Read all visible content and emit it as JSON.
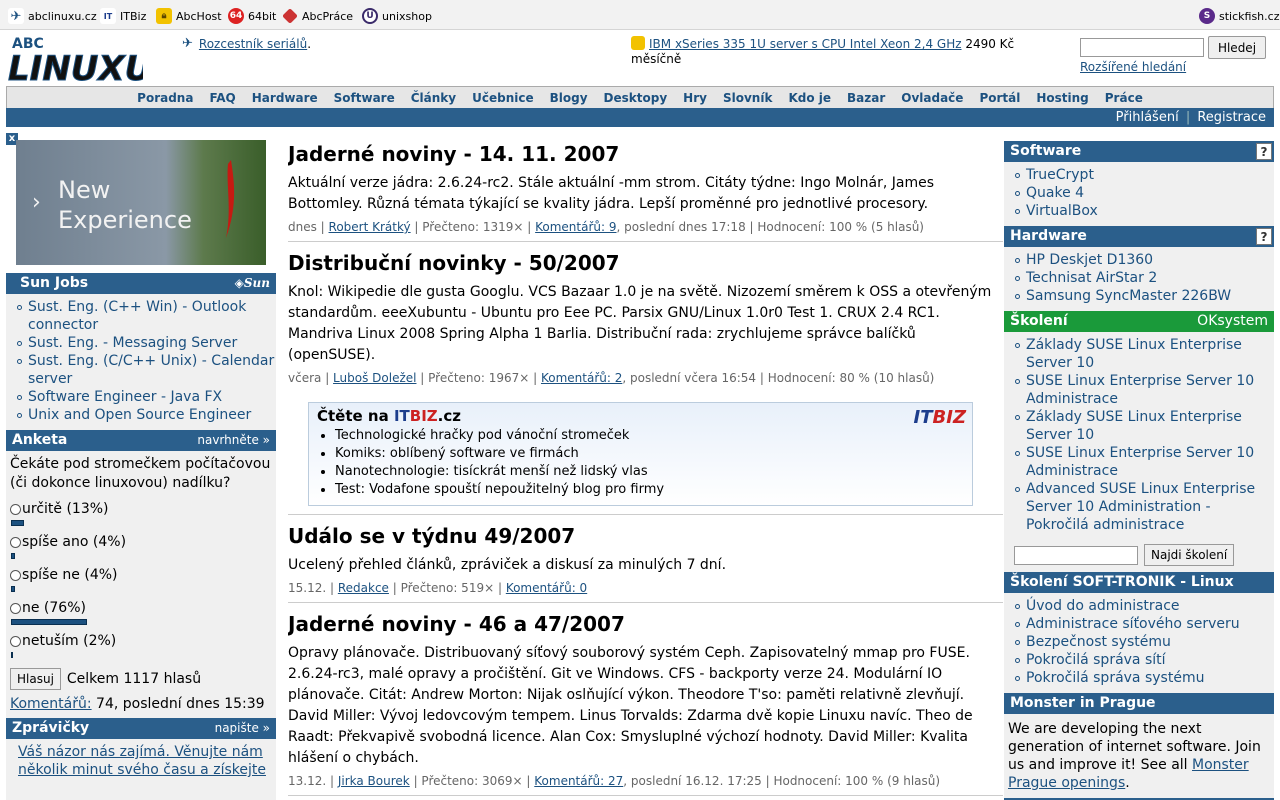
{
  "sitebar": {
    "left": [
      {
        "label": "abclinuxu.cz",
        "icon": "penguin-icon"
      },
      {
        "label": "ITBiz",
        "icon": "itbiz-icon"
      },
      {
        "label": "AbcHost",
        "icon": "lock-icon"
      },
      {
        "label": "64bit",
        "icon": "64bit-icon"
      },
      {
        "label": "AbcPráce",
        "icon": "abcprace-icon"
      },
      {
        "label": "unixshop",
        "icon": "unixshop-icon"
      }
    ],
    "right": {
      "label": "stickfish.cz",
      "icon": "stickfish-icon"
    }
  },
  "header": {
    "logo_text": "ABC LINUXU",
    "left_link": "Rozcestník seriálů",
    "left_suffix": ".",
    "mid_link": "IBM xSeries 335 1U server s CPU Intel Xeon 2,4 GHz",
    "mid_suffix": " 2490 Kč měsíčně",
    "search_button": "Hledej",
    "search_advanced": "Rozšířené hledání"
  },
  "menu": [
    "Poradna",
    "FAQ",
    "Hardware",
    "Software",
    "Články",
    "Učebnice",
    "Blogy",
    "Desktopy",
    "Hry",
    "Slovník",
    "Kdo je",
    "Bazar",
    "Ovladače",
    "Portál",
    "Hosting",
    "Práce"
  ],
  "login": {
    "login": "Přihlášení",
    "separator": "|",
    "register": "Registrace"
  },
  "ad": {
    "close": "x",
    "line1": "New",
    "line2": "Experience"
  },
  "sunjobs": {
    "title": "Sun Jobs",
    "logo": "Sun",
    "items": [
      "Sust. Eng. (C++ Win) - Outlook connector",
      "Sust. Eng. - Messaging Server",
      "Sust. Eng. (C/C++ Unix) - Calendar server",
      "Software Engineer - Java FX",
      "Unix and Open Source Engineer"
    ]
  },
  "poll": {
    "title": "Anketa",
    "action": "navrhněte »",
    "question": "Čekáte pod stromečkem počítačovou (či dokonce linuxovou) nadílku?",
    "options": [
      {
        "label": "určitě (13%)",
        "percent": 13
      },
      {
        "label": "spíše ano (4%)",
        "percent": 4
      },
      {
        "label": "spíše ne (4%)",
        "percent": 4
      },
      {
        "label": "ne (76%)",
        "percent": 76
      },
      {
        "label": "netuším (2%)",
        "percent": 2
      }
    ],
    "vote_button": "Hlasuj",
    "total": "Celkem 1117 hlasů",
    "comments_link": "Komentářů:",
    "comments_info": " 74, poslední dnes 15:39"
  },
  "news": {
    "title": "Zprávičky",
    "action": "napište »",
    "text": "Váš názor nás zajímá. Věnujte nám několik minut svého času a získejte"
  },
  "articles": [
    {
      "title": "Jaderné noviny - 14. 11. 2007",
      "perex": "Aktuální verze jádra: 2.6.24-rc2. Stále aktuální -mm strom. Citáty týdne: Ingo Molnár, James Bottomley. Různá témata týkající se kvality jádra. Lepší proměnné pro jednotlivé procesory.",
      "date": "dnes",
      "author": "Robert Krátký",
      "reads": "Přečteno: 1319×",
      "comments": "Komentářů: 9",
      "last": ", poslední dnes 17:18",
      "rating": "Hodnocení: 100 % (5 hlasů)"
    },
    {
      "title": "Distribuční novinky - 50/2007",
      "perex": "Knol: Wikipedie dle gusta Googlu. VCS Bazaar 1.0 je na světě. Nizozemí směrem k OSS a otevřeným standardům. eeeXubuntu - Ubuntu pro Eee PC. Parsix GNU/Linux 1.0r0 Test 1. CRUX 2.4 RC1. Mandriva Linux 2008 Spring Alpha 1 Barlia. Distribuční rada: zrychlujeme správce balíčků (openSUSE).",
      "date": "včera",
      "author": "Luboš Doležel",
      "reads": "Přečteno: 1967×",
      "comments": "Komentářů: 2",
      "last": ", poslední včera 16:54",
      "rating": "Hodnocení: 80 % (10 hlasů)"
    },
    {
      "title": "Událo se v týdnu 49/2007",
      "perex": "Ucelený přehled článků, zpráviček a diskusí za minulých 7 dní.",
      "date": "15.12.",
      "author": "Redakce",
      "reads": "Přečteno: 519×",
      "comments": "Komentářů: 0",
      "last": "",
      "rating": ""
    },
    {
      "title": "Jaderné noviny - 46 a 47/2007",
      "perex": "Opravy plánovače. Distribuovaný síťový souborový systém Ceph. Zapisovatelný mmap pro FUSE. 2.6.24-rc3, malé opravy a pročištění. Git ve Windows. CFS - backporty verze 24. Modulární IO plánovače. Citát: Andrew Morton: Nijak oslňující výkon. Theodore T'so: paměti relativně zlevňují. David Miller: Vývoj ledovcovým tempem. Linus Torvalds: Zdarma dvě kopie Linuxu navíc. Theo de Raadt: Překvapivě svobodná licence. Alan Cox: Smysluplné výchozí hodnoty. David Miller: Kvalita hlášení o chybách.",
      "date": "13.12.",
      "author": "Jirka Bourek",
      "reads": "Přečteno: 3069×",
      "comments": "Komentářů: 27",
      "last": ", poslední 16.12. 17:25",
      "rating": "Hodnocení: 100 % (9 hlasů)"
    }
  ],
  "itbiz": {
    "prefix": "Čtěte na ",
    "it": "IT",
    "biz": "BIZ",
    "suffix": ".cz",
    "logo": "ITBIZ",
    "items": [
      "Technologické hračky pod vánoční stromeček",
      "Komiks: oblíbený software ve firmách",
      "Nanotechnologie: tisíckrát menší než lidský vlas",
      "Test: Vodafone spouští nepoužitelný blog pro firmy"
    ]
  },
  "right": {
    "software": {
      "title": "Software",
      "help": "?",
      "items": [
        "TrueCrypt",
        "Quake 4",
        "VirtualBox"
      ]
    },
    "hardware": {
      "title": "Hardware",
      "help": "?",
      "items": [
        "HP Deskjet D1360",
        "Technisat AirStar 2",
        "Samsung SyncMaster 226BW"
      ]
    },
    "skoleni": {
      "title": "Školení",
      "sponsor": "OKsystem",
      "items": [
        "Základy SUSE Linux Enterprise Server 10",
        "SUSE Linux Enterprise Server 10 Administrace",
        "Základy SUSE Linux Enterprise Server 10",
        "SUSE Linux Enterprise Server 10 Administrace",
        "Advanced SUSE Linux Enterprise Server 10 Administration - Pokročilá administrace"
      ],
      "button": "Najdi školení"
    },
    "softtronik": {
      "title": "Školení SOFT-TRONIK - Linux",
      "items": [
        "Úvod do administrace",
        "Administrace síťového serveru",
        "Bezpečnost systému",
        "Pokročilá správa sítí",
        "Pokročilá správa systému"
      ]
    },
    "monster": {
      "title": "Monster in Prague",
      "text": "We are developing the next generation of internet software. Join us and improve it! See all ",
      "link": "Monster Prague openings",
      "suffix": "."
    }
  },
  "colors": {
    "accent": "#2b5f8c",
    "link": "#1c5180",
    "skoleni_green": "#1a9a3a"
  }
}
